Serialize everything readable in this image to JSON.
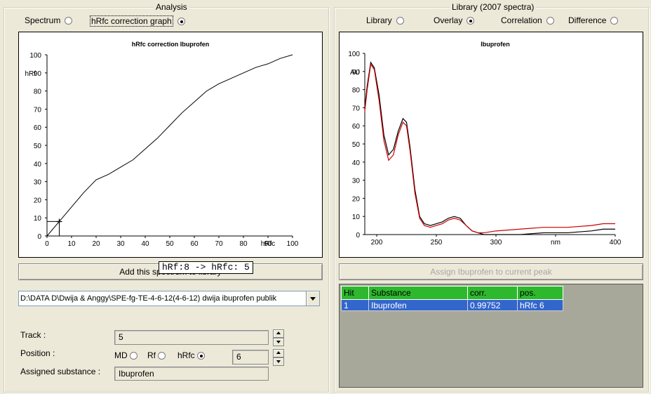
{
  "analysis": {
    "title": "Analysis",
    "radios": [
      {
        "label": "Spectrum",
        "selected": false
      },
      {
        "label": "hRfc correction graph",
        "selected": true
      }
    ],
    "add_button_label": "Add this spectrum to library",
    "tooltip": "hRf:8 -> hRfc: 5",
    "file_path": "D:\\DATA D\\Dwija & Anggy\\SPE-fg-TE-4-6-12(4-6-12) dwija ibuprofen publik",
    "track_label": "Track :",
    "track_value": "5",
    "position_label": "Position :",
    "position_options": [
      {
        "label": "MD",
        "selected": false
      },
      {
        "label": "Rf",
        "selected": false
      },
      {
        "label": "hRfc",
        "selected": true
      }
    ],
    "position_value": "6",
    "assigned_label": "Assigned substance :",
    "assigned_value": "Ibuprofen"
  },
  "library": {
    "title": "Library (2007 spectra)",
    "radios": [
      {
        "label": "Library",
        "selected": false
      },
      {
        "label": "Overlay",
        "selected": true
      },
      {
        "label": "Correlation",
        "selected": false
      },
      {
        "label": "Difference",
        "selected": false
      }
    ],
    "assign_button_label": "Assign Ibuprofen to current peak",
    "hits_headers": [
      "Hit",
      "Substance",
      "corr.",
      "pos."
    ],
    "hits_rows": [
      [
        "1",
        "Ibuprofen",
        "0.99752",
        "hRfc 6"
      ]
    ]
  },
  "chart_data": [
    {
      "type": "line",
      "title": "hRfc correction Ibuprofen",
      "xlabel": "hRfc",
      "ylabel": "hRf",
      "xlim": [
        0,
        100
      ],
      "ylim": [
        0,
        100
      ],
      "x_ticks": [
        "0",
        "10",
        "20",
        "30",
        "40",
        "50",
        "60",
        "70",
        "80",
        "90",
        "100"
      ],
      "y_ticks": [
        "0",
        "10",
        "20",
        "30",
        "40",
        "50",
        "60",
        "70",
        "80",
        "90",
        "100"
      ],
      "series": [
        {
          "color": "#000000",
          "x": [
            0,
            5,
            10,
            15,
            20,
            25,
            30,
            35,
            40,
            45,
            50,
            55,
            60,
            65,
            70,
            75,
            80,
            85,
            90,
            95,
            100
          ],
          "y": [
            0,
            8,
            16,
            24,
            31,
            34,
            38,
            42,
            48,
            54,
            61,
            68,
            74,
            80,
            84,
            87,
            90,
            93,
            95,
            98,
            100
          ]
        }
      ],
      "marker": {
        "x": 5,
        "y": 8
      }
    },
    {
      "type": "line",
      "title": "Ibuprofen",
      "xlabel": "nm",
      "ylabel": "AU",
      "xlim": [
        190,
        400
      ],
      "ylim": [
        0,
        100
      ],
      "x_ticks": [
        "200",
        "250",
        "300",
        "nm",
        "400"
      ],
      "y_ticks": [
        "0",
        "10",
        "20",
        "30",
        "40",
        "50",
        "60",
        "70",
        "80",
        "90",
        "100"
      ],
      "series": [
        {
          "color": "#000000",
          "x": [
            190,
            192,
            195,
            198,
            202,
            206,
            210,
            214,
            218,
            222,
            225,
            228,
            232,
            236,
            240,
            245,
            250,
            255,
            260,
            265,
            270,
            275,
            280,
            285,
            290,
            300,
            320,
            340,
            360,
            380,
            390,
            400
          ],
          "y": [
            70,
            82,
            95,
            92,
            77,
            55,
            44,
            47,
            57,
            64,
            62,
            48,
            25,
            10,
            6,
            5,
            6,
            7,
            9,
            10,
            9,
            5,
            2,
            1,
            0,
            0,
            0,
            1,
            1,
            2,
            3,
            3
          ]
        },
        {
          "color": "#cc0000",
          "x": [
            190,
            192,
            195,
            198,
            202,
            206,
            210,
            214,
            218,
            222,
            225,
            228,
            232,
            236,
            240,
            245,
            250,
            255,
            260,
            265,
            270,
            275,
            280,
            285,
            290,
            300,
            320,
            340,
            360,
            380,
            390,
            400
          ],
          "y": [
            68,
            80,
            94,
            91,
            74,
            52,
            41,
            44,
            55,
            62,
            60,
            46,
            23,
            9,
            5,
            4,
            5,
            6,
            8,
            9,
            8,
            5,
            2,
            1,
            1,
            2,
            3,
            4,
            4,
            5,
            6,
            6
          ]
        }
      ]
    }
  ]
}
